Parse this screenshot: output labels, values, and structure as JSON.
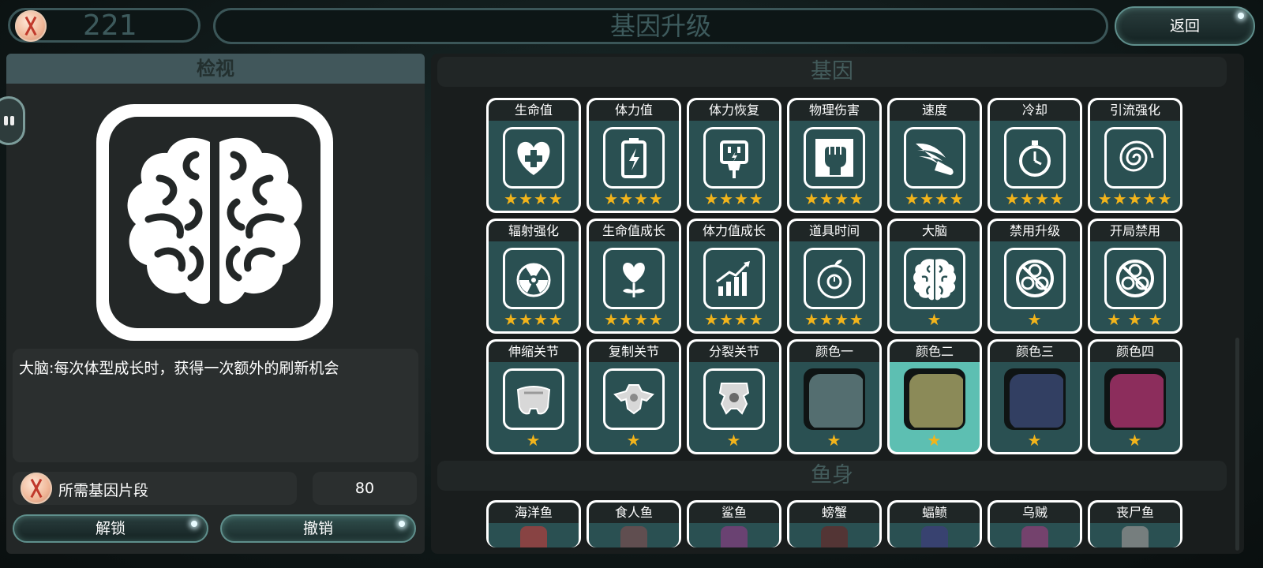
{
  "header": {
    "currency_amount": "221",
    "title": "基因升级",
    "back_label": "返回"
  },
  "inspect": {
    "title": "检视",
    "selected_icon": "brain-icon",
    "description": "大脑:每次体型成长时，获得一次额外的刷新机会",
    "requirement_label": "所需基因片段",
    "requirement_value": "80",
    "unlock_label": "解锁",
    "revoke_label": "撤销"
  },
  "genes": {
    "section_title": "基因",
    "cards": [
      {
        "label": "生命值",
        "icon": "heart-plus-icon",
        "stars": "★★★★"
      },
      {
        "label": "体力值",
        "icon": "battery-icon",
        "stars": "★★★★"
      },
      {
        "label": "体力恢复",
        "icon": "charging-plug-icon",
        "stars": "★★★★"
      },
      {
        "label": "物理伤害",
        "icon": "fist-icon",
        "stars": "★★★★"
      },
      {
        "label": "速度",
        "icon": "winged-shoe-icon",
        "stars": "★★★★"
      },
      {
        "label": "冷却",
        "icon": "stopwatch-icon",
        "stars": "★★★★"
      },
      {
        "label": "引流强化",
        "icon": "vortex-icon",
        "stars": "★★★★★"
      },
      {
        "label": "辐射强化",
        "icon": "radiation-icon",
        "stars": "★★★★"
      },
      {
        "label": "生命值成长",
        "icon": "heart-growth-icon",
        "stars": "★★★★"
      },
      {
        "label": "体力值成长",
        "icon": "growth-chart-icon",
        "stars": "★★★★"
      },
      {
        "label": "道具时间",
        "icon": "fruit-timer-icon",
        "stars": "★★★★"
      },
      {
        "label": "大脑",
        "icon": "brain-icon",
        "stars": "★"
      },
      {
        "label": "禁用升级",
        "icon": "biohazard-ban-icon",
        "stars": "★"
      },
      {
        "label": "开局禁用",
        "icon": "biohazard-ban-icon",
        "stars": "★ ★ ★"
      },
      {
        "label": "伸缩关节",
        "icon": "joint-icon",
        "stars": "★"
      },
      {
        "label": "复制关节",
        "icon": "vertebra-icon",
        "stars": "★"
      },
      {
        "label": "分裂关节",
        "icon": "split-joint-icon",
        "stars": "★"
      },
      {
        "label": "颜色一",
        "icon": "color-swatch",
        "color": "#546e70",
        "stars": "★"
      },
      {
        "label": "颜色二",
        "icon": "color-swatch",
        "color": "#8b8a58",
        "stars": "★"
      },
      {
        "label": "颜色三",
        "icon": "color-swatch",
        "color": "#323f62",
        "stars": "★"
      },
      {
        "label": "颜色四",
        "icon": "color-swatch",
        "color": "#8c2d5c",
        "stars": "★"
      }
    ]
  },
  "body_section": {
    "section_title": "鱼身",
    "cards": [
      {
        "label": "海洋鱼",
        "color": "#a04040"
      },
      {
        "label": "食人鱼",
        "color": "#6e4e50"
      },
      {
        "label": "鲨鱼",
        "color": "#7a3e7a"
      },
      {
        "label": "螃蟹",
        "color": "#5e2e2e"
      },
      {
        "label": "蝠鲼",
        "color": "#3c3e78"
      },
      {
        "label": "乌贼",
        "color": "#873e74"
      },
      {
        "label": "丧尸鱼",
        "color": "#8a8a8a"
      }
    ]
  },
  "colors": {
    "accent": "#5dbfb2",
    "card_bg": "#2a5052",
    "star": "#f2b41b"
  }
}
